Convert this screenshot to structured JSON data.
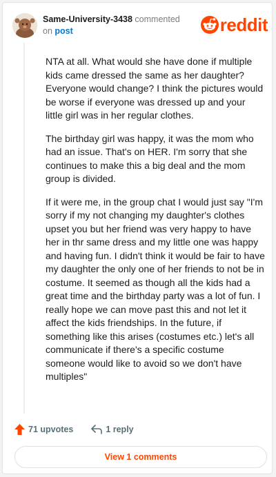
{
  "comment": {
    "author": "Same-University-3438",
    "action_text": "commented",
    "on_text": "on",
    "post_link": "post",
    "paragraphs": [
      "NTA at all. What would she have done if multiple kids came dressed the same as her daughter? Everyone would change? I think the pictures would be worse if everyone was dressed up and your little girl was in her regular clothes.",
      "The birthday girl was happy, it was the mom who had an issue. That's on HER. I'm sorry that she continues to make this a big deal and the mom group is divided.",
      "If it were me, in the group chat I would just say \"I'm sorry if my not changing my daughter's clothes upset you but her friend was very happy to have her in thr same dress and my little one was happy and having fun. I didn't think it would be fair to have my daughter the only one of her friends to not be in costume. It seemed as though all the kids had a great time and the birthday party was a lot of fun. I really hope we can move past this and not let it affect the kids friendships. In the future, if something like this arises (costumes etc.) let's all communicate if there's a specific costume someone would like to avoid so we don't have multiples\""
    ]
  },
  "brand": {
    "name": "reddit",
    "color": "#ff4500"
  },
  "actions": {
    "upvotes": "71 upvotes",
    "replies": "1 reply",
    "upvote_icon": "upvote-arrow-icon",
    "reply_icon": "reply-arrow-icon"
  },
  "footer": {
    "view_comments": "View 1 comments"
  }
}
